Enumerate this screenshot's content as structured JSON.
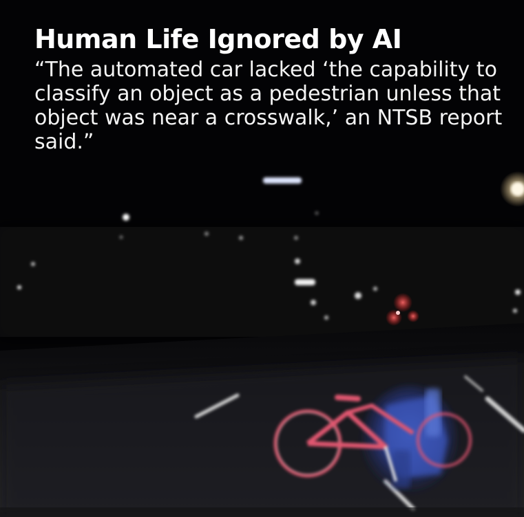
{
  "headline": "Human Life Ignored by AI",
  "quote": "“The automated car lacked ‘the capability to classify an object as a pedestrian unless that object was near a crosswalk,’ an NTSB report said.”",
  "scene": {
    "description_icon": "dashcam-night-road-bicycle",
    "colors": {
      "sky": "#030305",
      "road": "#1a1a1c",
      "bicycle": "#e0566f",
      "pedestrian": "#3a54b8",
      "lane_marking": "#d8d8d8"
    }
  }
}
